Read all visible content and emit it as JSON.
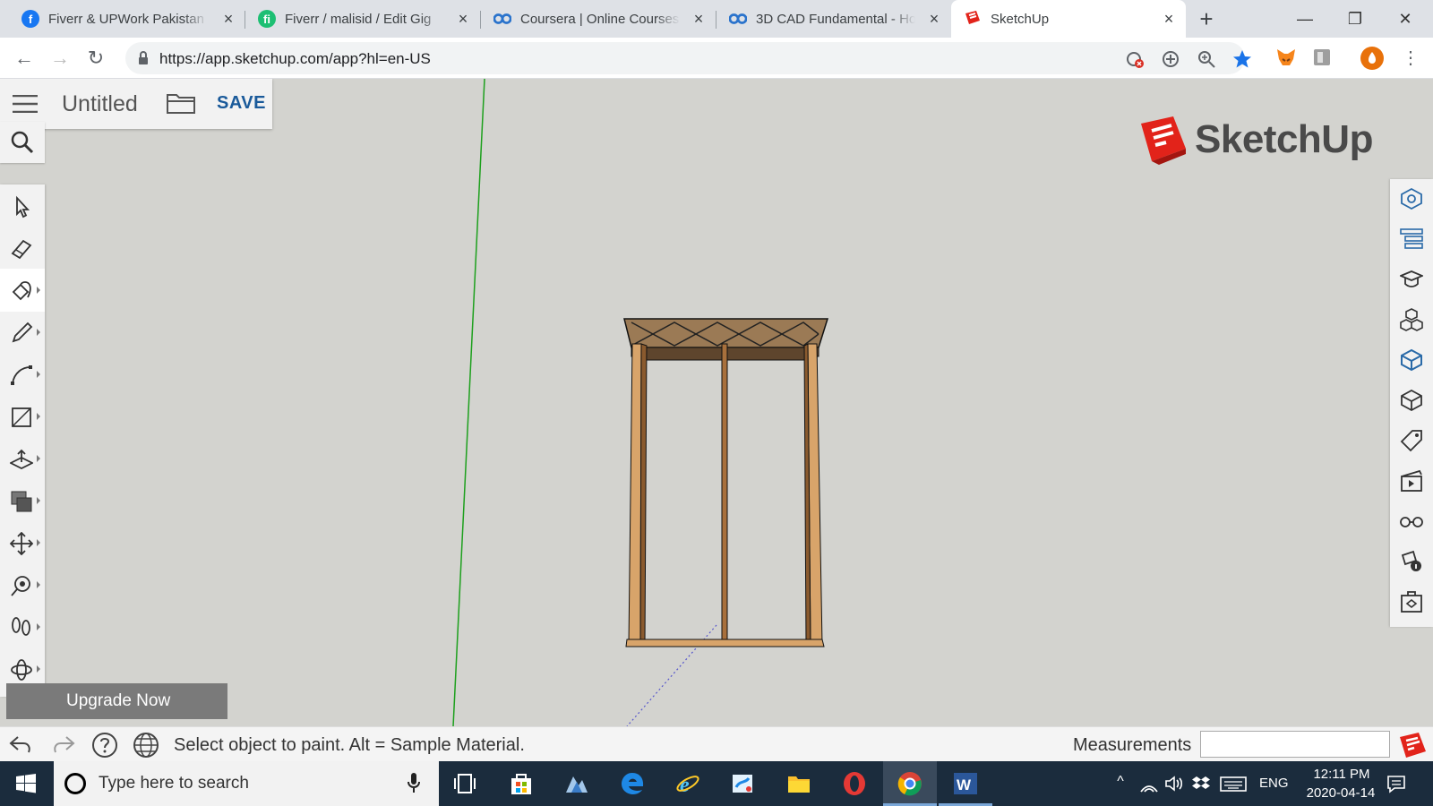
{
  "browser": {
    "tabs": [
      {
        "title": "Fiverr & UPWork Pakistan |",
        "favicon": "facebook-icon",
        "color": "#1877f2"
      },
      {
        "title": "Fiverr / malisid / Edit Gig",
        "favicon": "fiverr-icon",
        "color": "#1dbf73"
      },
      {
        "title": "Coursera | Online Courses F",
        "favicon": "coursera-icon",
        "color": "#2a73cc"
      },
      {
        "title": "3D CAD Fundamental - Ho",
        "favicon": "coursera-icon",
        "color": "#2a73cc"
      },
      {
        "title": "SketchUp",
        "favicon": "sketchup-icon",
        "color": "#e2231a",
        "active": true
      }
    ],
    "new_tab_label": "+",
    "url": "https://app.sketchup.com/app?hl=en-US"
  },
  "app": {
    "doc_title": "Untitled",
    "save_label": "SAVE",
    "logo_text": "SketchUp",
    "upgrade_label": "Upgrade Now",
    "brand_color": "#e2231a",
    "left_tools": [
      "select-tool-icon",
      "eraser-tool-icon",
      "paint-bucket-tool-icon",
      "pencil-line-tool-icon",
      "arc-tool-icon",
      "rectangle-tool-icon",
      "push-pull-tool-icon",
      "offset-tool-icon",
      "move-tool-icon",
      "tape-measure-tool-icon",
      "walk-tool-icon",
      "orbit-tool-icon"
    ],
    "selected_tool": "paint-bucket-tool-icon",
    "right_tools": [
      "entity-info-icon",
      "outliner-icon",
      "instructor-icon",
      "components-icon",
      "materials-icon",
      "styles-icon",
      "tags-icon",
      "scenes-icon",
      "display-icon",
      "model-info-icon",
      "solid-inspector-icon"
    ]
  },
  "status": {
    "message": "Select object to paint. Alt = Sample Material.",
    "measurements_label": "Measurements",
    "measurements_value": ""
  },
  "taskbar": {
    "search_placeholder": "Type here to search",
    "apps": [
      "task-view-icon",
      "store-icon",
      "photos-icon",
      "edge-icon",
      "ie-icon",
      "paint-icon",
      "file-explorer-icon",
      "opera-icon",
      "chrome-icon",
      "word-icon"
    ],
    "language": "ENG",
    "time": "12:11 PM",
    "date": "2020-04-14"
  }
}
